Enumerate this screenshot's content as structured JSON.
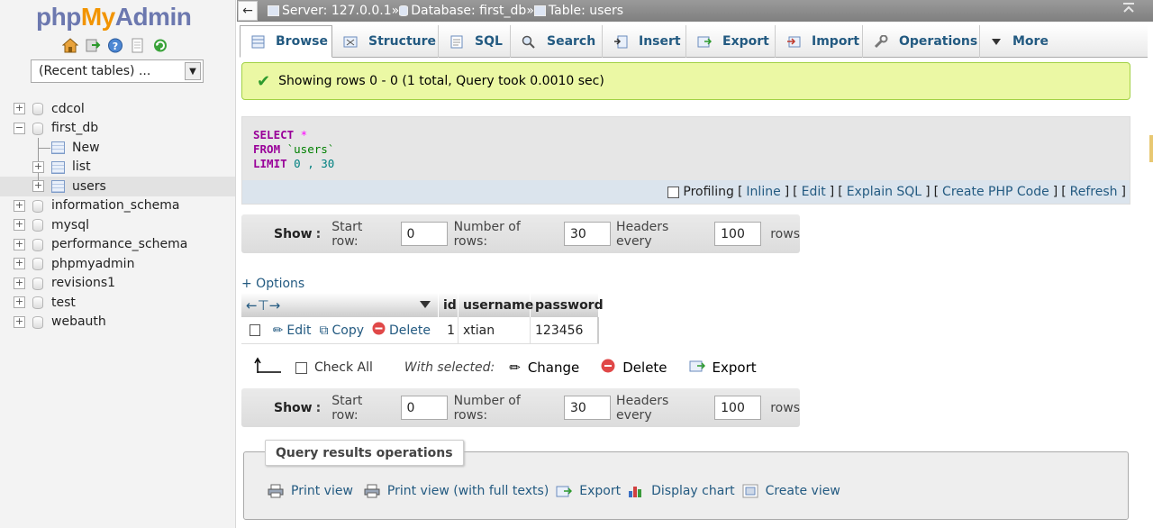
{
  "app": {
    "logo_php": "php",
    "logo_my": "My",
    "logo_admin": "Admin",
    "recent_tables": "(Recent tables) ..."
  },
  "tree": {
    "databases": [
      {
        "name": "cdcol",
        "expanded": false
      },
      {
        "name": "first_db",
        "expanded": true
      },
      {
        "name": "information_schema",
        "expanded": false
      },
      {
        "name": "mysql",
        "expanded": false
      },
      {
        "name": "performance_schema",
        "expanded": false
      },
      {
        "name": "phpmyadmin",
        "expanded": false
      },
      {
        "name": "revisions1",
        "expanded": false
      },
      {
        "name": "test",
        "expanded": false
      },
      {
        "name": "webauth",
        "expanded": false
      }
    ],
    "first_db_children": [
      "New",
      "list",
      "users"
    ],
    "selected_table": "users"
  },
  "breadcrumb": {
    "server": "Server: 127.0.0.1",
    "database": "Database: first_db",
    "table": "Table: users",
    "separator": "»"
  },
  "tabs": [
    {
      "label": "Browse",
      "icon": "browse-icon",
      "active": true
    },
    {
      "label": "Structure",
      "icon": "structure-icon"
    },
    {
      "label": "SQL",
      "icon": "sql-icon"
    },
    {
      "label": "Search",
      "icon": "search-icon"
    },
    {
      "label": "Insert",
      "icon": "insert-icon"
    },
    {
      "label": "Export",
      "icon": "export-icon"
    },
    {
      "label": "Import",
      "icon": "import-icon"
    },
    {
      "label": "Operations",
      "icon": "wrench-icon"
    },
    {
      "label": "More",
      "icon": "chevron-down-icon"
    }
  ],
  "message": "Showing rows 0 - 0 (1 total, Query took 0.0010 sec)",
  "sql": {
    "select_kw": "SELECT",
    "select_rest": " *",
    "from_kw": "FROM",
    "from_rest": " `users`",
    "limit_kw": "LIMIT",
    "limit_rest": " 0 , 30"
  },
  "sql_footer": {
    "profiling": "Profiling",
    "inline": "Inline",
    "edit": "Edit",
    "explain": "Explain SQL",
    "php": "Create PHP Code",
    "refresh": "Refresh"
  },
  "nav": {
    "show": "Show",
    "start_row_label": "Start row:",
    "start_row": "0",
    "num_rows_label": "Number of rows:",
    "num_rows": "30",
    "headers_every_label": "Headers every",
    "headers_every": "100",
    "rows_label": "rows"
  },
  "options_link": "+ Options",
  "table": {
    "columns": [
      "id",
      "username",
      "password"
    ],
    "rows": [
      {
        "id": "1",
        "username": "xtian",
        "password": "123456"
      }
    ],
    "row_actions": {
      "edit": "Edit",
      "copy": "Copy",
      "delete": "Delete"
    }
  },
  "bulk": {
    "check_all": "Check All",
    "with_selected": "With selected:",
    "change": "Change",
    "delete": "Delete",
    "export": "Export"
  },
  "query_ops": {
    "legend": "Query results operations",
    "items": [
      "Print view",
      "Print view (with full texts)",
      "Export",
      "Display chart",
      "Create view"
    ]
  }
}
